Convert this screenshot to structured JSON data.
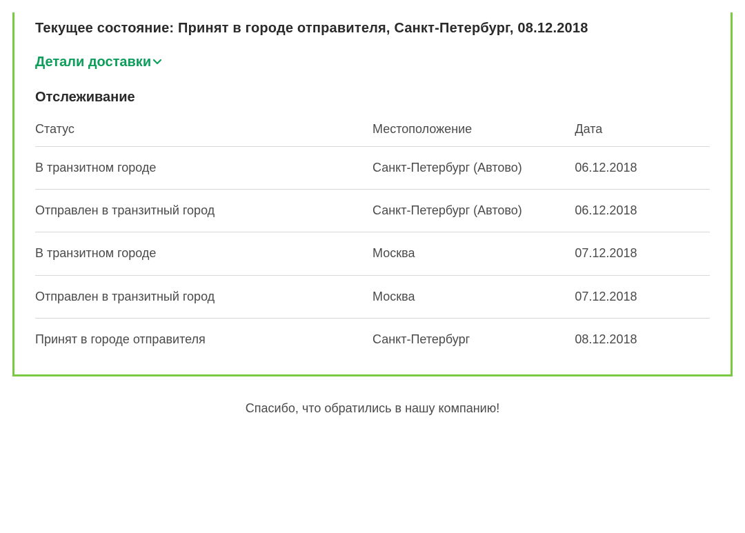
{
  "status_label": "Текущее состояние:",
  "status_text": "Принят в городе отправителя, Санкт-Петербург, 08.12.2018",
  "details_toggle": "Детали доставки",
  "tracking_title": "Отслеживание",
  "columns": {
    "status": "Статус",
    "location": "Местоположение",
    "date": "Дата"
  },
  "rows": [
    {
      "status": "В транзитном городе",
      "location": "Санкт-Петербург (Автово)",
      "date": "06.12.2018"
    },
    {
      "status": "Отправлен в транзитный город",
      "location": "Санкт-Петербург (Автово)",
      "date": "06.12.2018"
    },
    {
      "status": "В транзитном городе",
      "location": "Москва",
      "date": "07.12.2018"
    },
    {
      "status": "Отправлен в транзитный город",
      "location": "Москва",
      "date": "07.12.2018"
    },
    {
      "status": "Принят в городе отправителя",
      "location": "Санкт-Петербург",
      "date": "08.12.2018"
    }
  ],
  "footer": "Спасибо, что обратились в нашу компанию!",
  "accent_color": "#0c9e5a",
  "border_color": "#7ac943"
}
